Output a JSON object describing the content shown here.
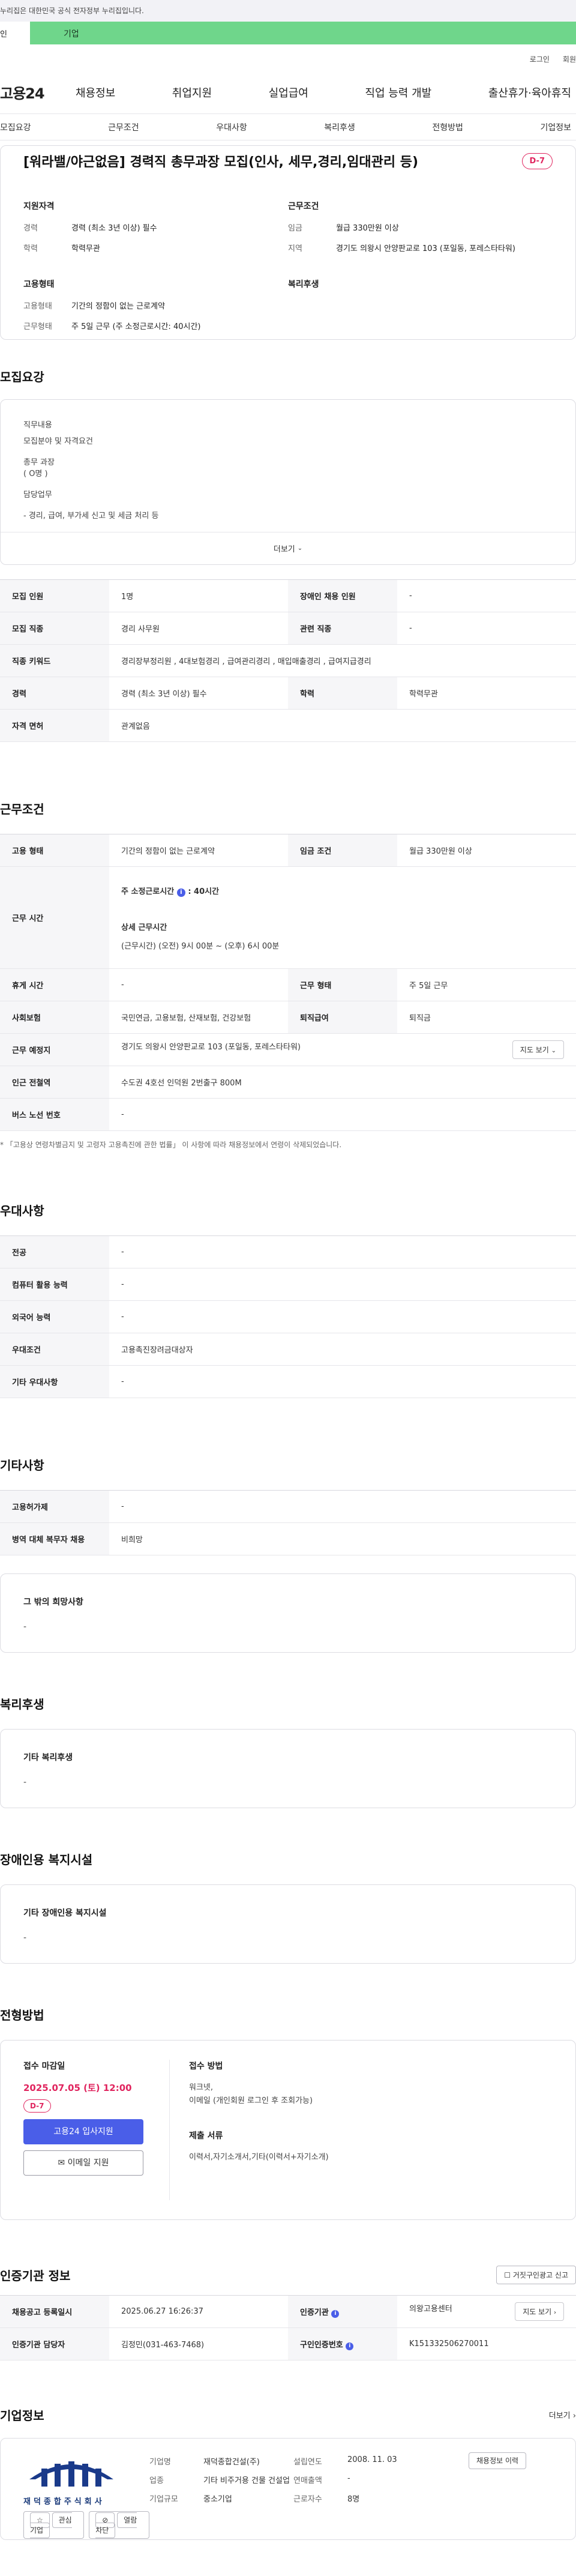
{
  "gov_banner": "누리집은 대한민국 공식 전자정부 누리집입니다.",
  "toggle": {
    "personal": "인",
    "company": "기업"
  },
  "util": {
    "login": "로그인",
    "join": "회원"
  },
  "gnb": {
    "logo": "고용24",
    "menu": [
      "채용정보",
      "취업지원",
      "실업급여",
      "직업 능력 개발",
      "출산휴가·육아휴직"
    ]
  },
  "tabs": [
    "모집요강",
    "근무조건",
    "우대사항",
    "복리후생",
    "전형방법",
    "기업정보"
  ],
  "summary": {
    "title": "[워라밸/야근없음] 경력직 총무과장 모집(인사, 세무,경리,임대관리 등)",
    "dday": "D-7",
    "qual_heading": "지원자격",
    "career_label": "경력",
    "career_value": "경력 (최소 3년 이상) 필수",
    "edu_label": "학력",
    "edu_value": "학력무관",
    "cond_heading": "근무조건",
    "wage_label": "임금",
    "wage_value": "월급 330만원 이상",
    "area_label": "지역",
    "area_value": "경기도 의왕시 안양판교로 103 (포일동, 포레스타타워)",
    "emp_heading": "고용형태",
    "type_label": "고용형태",
    "type_value": "기간의 정함이 없는 근로계약",
    "shape_label": "근무형태",
    "shape_value": "주 5일 근무 (주 소정근로시간: 40시간)",
    "welfare_heading": "복리후생"
  },
  "recruit": {
    "title": "모집요강",
    "lines": [
      "직무내용",
      "모집분야 및 자격요건",
      "총무 과장",
      "( O명 )",
      "담당업무",
      "- 경리, 급여, 부가세 신고 및 세금 처리 등"
    ],
    "more": "더보기",
    "rows": [
      [
        "모집 인원",
        "1명",
        "장애인 채용 인원",
        "-"
      ],
      [
        "모집 직종",
        "경리 사무원",
        "관련 직종",
        "-"
      ],
      [
        "직종 키워드",
        "경리장부정리원 , 4대보험경리 , 급여관리경리 , 매입매출경리 , 급여지급경리",
        "",
        ""
      ],
      [
        "경력",
        "경력 (최소 3년 이상) 필수",
        "학력",
        "학력무관"
      ],
      [
        "자격 면허",
        "관계없음",
        "",
        ""
      ]
    ]
  },
  "work": {
    "title": "근무조건",
    "type_label": "고용 형태",
    "type_value": "기간의 정함이 없는 근로계약",
    "wage_label": "임금 조건",
    "wage_value": "월급 330만원 이상",
    "time_label": "근무 시간",
    "weekly_label": "주 소정근로시간",
    "weekly_value": ": 40시간",
    "detail_label": "상세 근무시간",
    "detail_value": "(근무시간) (오전) 9시 00분 ~ (오후) 6시 00분",
    "rest_label": "휴게 시간",
    "rest_value": "-",
    "shape_label": "근무 형태",
    "shape_value": "주 5일 근무",
    "ins_label": "사회보험",
    "ins_value": "국민연금, 고용보험, 산재보험, 건강보험",
    "ret_label": "퇴직급여",
    "ret_value": "퇴직금",
    "place_label": "근무 예정지",
    "place_value": "경기도 의왕시 안양판교로 103 (포일동, 포레스타타워)",
    "map_btn": "지도 보기",
    "subway_label": "인근 전철역",
    "subway_value": "수도권 4호선 인덕원 2번출구 800M",
    "bus_label": "버스 노선 번호",
    "bus_value": "-",
    "note": "* 「고용상 연령차별금지 및 고령자 고용촉진에 관한 법률」 이 사항에 따라 채용정보에서 연령이 삭제되었습니다."
  },
  "pref": {
    "title": "우대사항",
    "rows": [
      [
        "전공",
        "-"
      ],
      [
        "컴퓨터 활용 능력",
        "-"
      ],
      [
        "외국어 능력",
        "-"
      ],
      [
        "우대조건",
        "고용촉진장려금대상자"
      ],
      [
        "기타 우대사항",
        "-"
      ]
    ]
  },
  "etc": {
    "title": "기타사항",
    "rows": [
      [
        "고용허가제",
        "-"
      ],
      [
        "병역 대체 복무자 채용",
        "비희망"
      ]
    ],
    "wish_label": "그 밖의 희망사항",
    "wish_value": "-"
  },
  "welfare": {
    "title": "복리후생",
    "label": "기타 복리후생",
    "value": "-"
  },
  "disability": {
    "title": "장애인용 복지시설",
    "label": "기타 장애인용 복지시설",
    "value": "-"
  },
  "apply": {
    "title": "전형방법",
    "deadline_label": "접수 마감일",
    "deadline": "2025.07.05 (토) 12:00",
    "dday": "D-7",
    "apply_btn": "고용24 입사지원",
    "email_btn": "이메일 지원",
    "method_label": "접수 방법",
    "method_value_1": "워크넷,",
    "method_value_2": "이메일 (개인회원 로그인 후 조회가능)",
    "docs_label": "제출 서류",
    "docs_value": "이력서,자기소개서,기타(이력서+자기소개)"
  },
  "cert": {
    "title": "인증기관 정보",
    "report_btn": "거짓구인광고 신고",
    "reg_label": "채용공고 등록일시",
    "reg_value": "2025.06.27 16:26:37",
    "org_label": "인증기관",
    "org_value": "의왕고용센터",
    "map_btn": "지도 보기",
    "mgr_label": "인증기관 담당자",
    "mgr_value": "김정민(031-463-7468)",
    "num_label": "구인인증번호",
    "num_value": "K151332506270011"
  },
  "company": {
    "title": "기업정보",
    "more": "더보기",
    "logo_text": "재덕종합주식회사",
    "interest_btn": "관심기업",
    "block_btn": "열람차단",
    "name_label": "기업명",
    "name_value": "재덕종합건설(주)",
    "est_label": "설립연도",
    "est_value": "2008. 11. 03",
    "industry_label": "업종",
    "industry_value": "기타 비주거용 건물 건설업",
    "sales_label": "연매출액",
    "sales_value": "-",
    "emp_label": "근로자수",
    "emp_value": "8명",
    "size_label": "기업규모",
    "size_value": "중소기업",
    "jobs_btn": "채용정보 이력"
  }
}
